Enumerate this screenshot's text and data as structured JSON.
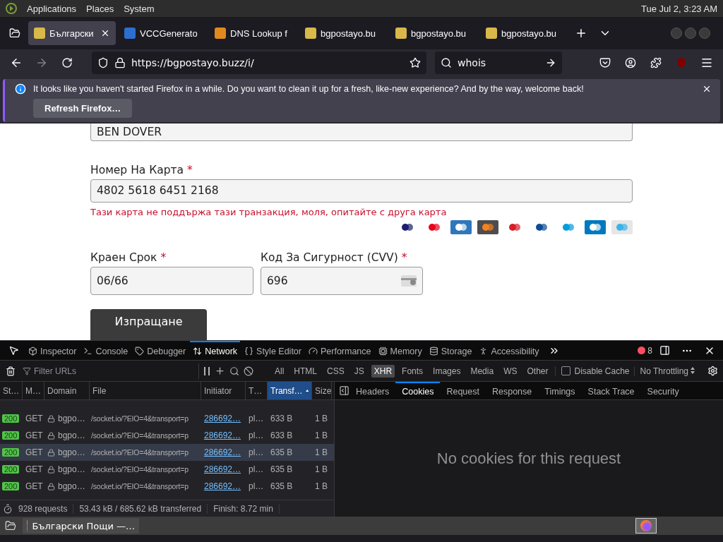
{
  "top_panel": {
    "menus": [
      "Applications",
      "Places",
      "System"
    ],
    "clock": "Tue Jul  2,  3:23 AM"
  },
  "tabs": [
    {
      "title": "Български",
      "selected": true
    },
    {
      "title": "VCCGenerato",
      "selected": false
    },
    {
      "title": "DNS Lookup f",
      "selected": false
    },
    {
      "title": "bgpostayo.bu",
      "selected": false
    },
    {
      "title": "bgpostayo.bu",
      "selected": false
    },
    {
      "title": "bgpostayo.bu",
      "selected": false
    }
  ],
  "address_bar": {
    "url": "https://bgpostayo.buzz/i/"
  },
  "search": {
    "value": "whois"
  },
  "notification": {
    "message": "It looks like you haven't started Firefox in a while. Do you want to clean it up for a fresh, like-new experience? And by the way, welcome back!",
    "button": "Refresh Firefox…"
  },
  "form": {
    "name_field": {
      "value": "BEN DOVER"
    },
    "card_number": {
      "label": "Номер На Карта",
      "required_mark": "*",
      "value": "4802 5618 6451 2168",
      "error": "Тази карта не поддържа тази транзакция, моля, опитайте с друга карта"
    },
    "expiry": {
      "label": "Краен Срок",
      "required_mark": "*",
      "value": "06/66"
    },
    "cvv": {
      "label": "Код За Сигурност (CVV)",
      "required_mark": "*",
      "value": "696"
    },
    "submit": "Изпращане"
  },
  "devtools": {
    "tools": [
      {
        "label": "Inspector",
        "selected": false
      },
      {
        "label": "Console",
        "selected": false
      },
      {
        "label": "Debugger",
        "selected": false
      },
      {
        "label": "Network",
        "selected": true
      },
      {
        "label": "Style Editor",
        "selected": false
      },
      {
        "label": "Performance",
        "selected": false
      },
      {
        "label": "Memory",
        "selected": false
      },
      {
        "label": "Storage",
        "selected": false
      },
      {
        "label": "Accessibility",
        "selected": false
      }
    ],
    "error_count": "8",
    "filter": {
      "placeholder": "Filter URLs"
    },
    "type_filters": [
      {
        "label": "All",
        "selected": false
      },
      {
        "label": "HTML",
        "selected": false
      },
      {
        "label": "CSS",
        "selected": false
      },
      {
        "label": "JS",
        "selected": false
      },
      {
        "label": "XHR",
        "selected": true
      },
      {
        "label": "Fonts",
        "selected": false
      },
      {
        "label": "Images",
        "selected": false
      },
      {
        "label": "Media",
        "selected": false
      },
      {
        "label": "WS",
        "selected": false
      },
      {
        "label": "Other",
        "selected": false
      }
    ],
    "disable_cache": {
      "label": "Disable Cache",
      "checked": false
    },
    "throttling": "No Throttling",
    "table": {
      "columns": [
        {
          "label": "St…",
          "selected": false
        },
        {
          "label": "M…",
          "selected": false
        },
        {
          "label": "Domain",
          "selected": false
        },
        {
          "label": "File",
          "selected": false
        },
        {
          "label": "Initiator",
          "selected": false
        },
        {
          "label": "T…",
          "selected": false
        },
        {
          "label": "Transf…",
          "selected": true
        },
        {
          "label": "Size",
          "selected": false
        }
      ],
      "rows": [
        {
          "status": "200",
          "method": "GET",
          "domain": "bgpo…",
          "file": "/socket.io/?EIO=4&transport=p",
          "initiator": "286692…",
          "type": "pl…",
          "transferred": "633 B",
          "size": "1 B",
          "selected": false
        },
        {
          "status": "200",
          "method": "GET",
          "domain": "bgpo…",
          "file": "/socket.io/?EIO=4&transport=p",
          "initiator": "286692…",
          "type": "pl…",
          "transferred": "633 B",
          "size": "1 B",
          "selected": false
        },
        {
          "status": "200",
          "method": "GET",
          "domain": "bgpo…",
          "file": "/socket.io/?EIO=4&transport=p",
          "initiator": "286692…",
          "type": "pl…",
          "transferred": "635 B",
          "size": "1 B",
          "selected": true
        },
        {
          "status": "200",
          "method": "GET",
          "domain": "bgpo…",
          "file": "/socket.io/?EIO=4&transport=p",
          "initiator": "286692…",
          "type": "pl…",
          "transferred": "635 B",
          "size": "1 B",
          "selected": false
        },
        {
          "status": "200",
          "method": "GET",
          "domain": "bgpo…",
          "file": "/socket.io/?EIO=4&transport=p",
          "initiator": "286692…",
          "type": "pl…",
          "transferred": "635 B",
          "size": "1 B",
          "selected": false
        }
      ]
    },
    "status_bar": [
      "928 requests",
      "53.43 kB / 685.62 kB transferred",
      "Finish: 8.72 min"
    ],
    "detail_tabs": [
      {
        "label": "Headers",
        "selected": false
      },
      {
        "label": "Cookies",
        "selected": true
      },
      {
        "label": "Request",
        "selected": false
      },
      {
        "label": "Response",
        "selected": false
      },
      {
        "label": "Timings",
        "selected": false
      },
      {
        "label": "Stack Trace",
        "selected": false
      },
      {
        "label": "Security",
        "selected": false
      }
    ],
    "empty_message": "No cookies for this request"
  },
  "taskbar": {
    "windows": [
      "Български Пощи —…"
    ]
  }
}
